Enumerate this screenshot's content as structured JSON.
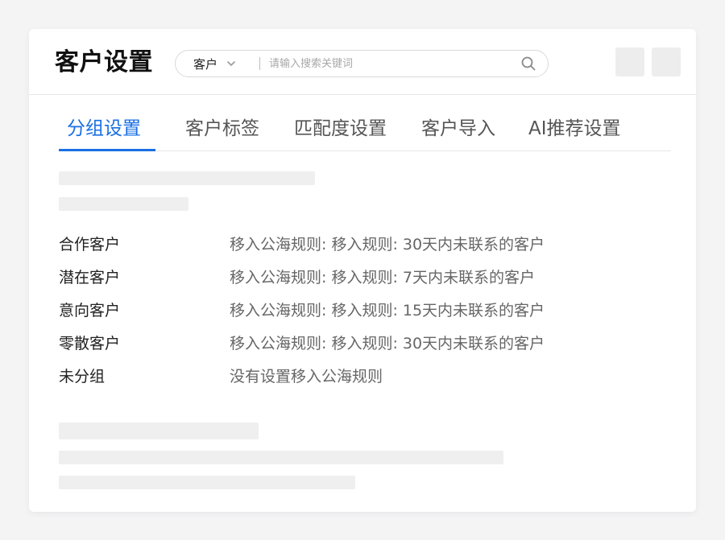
{
  "header": {
    "title": "客户设置",
    "search": {
      "scope": "客户",
      "placeholder": "请输入搜索关键词",
      "value": ""
    },
    "icons": [
      "chevron-down-icon",
      "search-icon"
    ]
  },
  "tabs": [
    {
      "label": "分组设置",
      "active": true
    },
    {
      "label": "客户标签",
      "active": false
    },
    {
      "label": "匹配度设置",
      "active": false
    },
    {
      "label": "客户导入",
      "active": false
    },
    {
      "label": "AI推荐设置",
      "active": false
    }
  ],
  "groups": [
    {
      "name": "合作客户",
      "rule": "移入公海规则: 移入规则: 30天内未联系的客户"
    },
    {
      "name": "潜在客户",
      "rule": "移入公海规则: 移入规则: 7天内未联系的客户"
    },
    {
      "name": "意向客户",
      "rule": "移入公海规则: 移入规则: 15天内未联系的客户"
    },
    {
      "name": "零散客户",
      "rule": "移入公海规则: 移入规则: 30天内未联系的客户"
    },
    {
      "name": "未分组",
      "rule": "没有设置移入公海规则"
    }
  ],
  "colors": {
    "accent": "#1a6fe3",
    "skeleton": "#efefef",
    "background": "#f4f4f5"
  }
}
